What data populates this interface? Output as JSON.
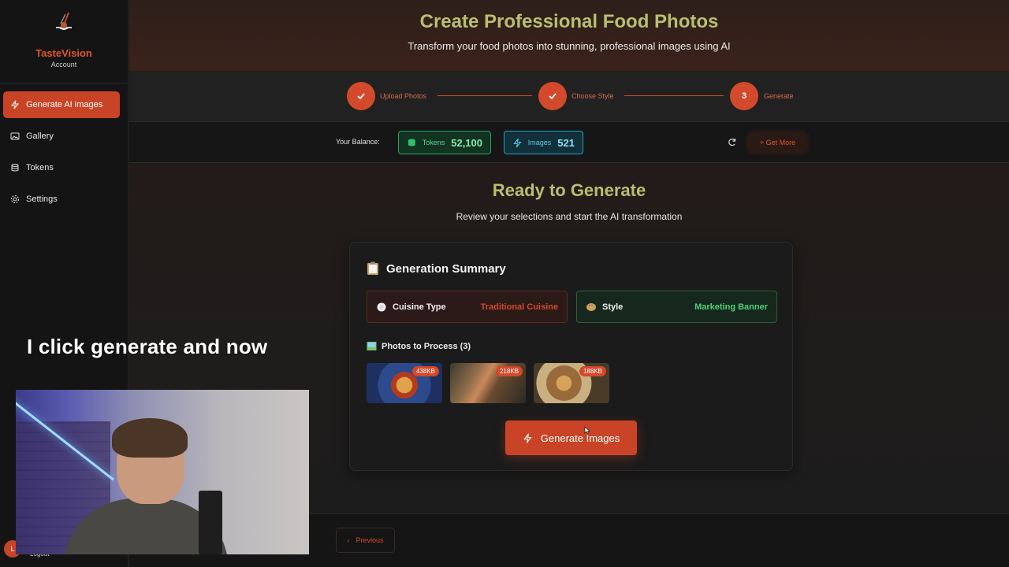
{
  "brand": {
    "name": "TasteVision",
    "sub": "Account"
  },
  "sidebar": {
    "items": [
      {
        "label": "Generate AI images",
        "icon": "lightning-icon",
        "active": true
      },
      {
        "label": "Gallery",
        "icon": "image-icon"
      },
      {
        "label": "Tokens",
        "icon": "coins-icon"
      },
      {
        "label": "Settings",
        "icon": "gear-icon"
      }
    ],
    "user_initial": "L",
    "logout": "Logout"
  },
  "hero": {
    "title": "Create Professional Food Photos",
    "subtitle": "Transform your food photos into stunning, professional images using AI"
  },
  "stepper": {
    "steps": [
      {
        "label": "Upload Photos",
        "state": "done"
      },
      {
        "label": "Choose Style",
        "state": "done"
      },
      {
        "label": "Generate",
        "state": "current",
        "number": "3"
      }
    ]
  },
  "balance": {
    "label": "Your Balance:",
    "tokens_label": "Tokens",
    "tokens_value": "52,100",
    "images_label": "Images",
    "images_value": "521",
    "get_more": "+ Get More"
  },
  "ready": {
    "title": "Ready to Generate",
    "subtitle": "Review your selections and start the AI transformation"
  },
  "summary": {
    "title": "Generation Summary",
    "cuisine_label": "Cuisine Type",
    "cuisine_value": "Traditional Cuisine",
    "style_label": "Style",
    "style_value": "Marketing Banner",
    "photos_label": "Photos to Process (3)",
    "photos": [
      {
        "size": "438KB"
      },
      {
        "size": "218KB"
      },
      {
        "size": "188KB"
      }
    ],
    "generate_button": "Generate Images"
  },
  "footer": {
    "previous": "Previous"
  },
  "overlay": {
    "caption": "I click generate and now"
  },
  "colors": {
    "accent": "#c94426",
    "title": "#b9bf6f",
    "tokens": "#29a35d",
    "images": "#2a9dc0"
  }
}
